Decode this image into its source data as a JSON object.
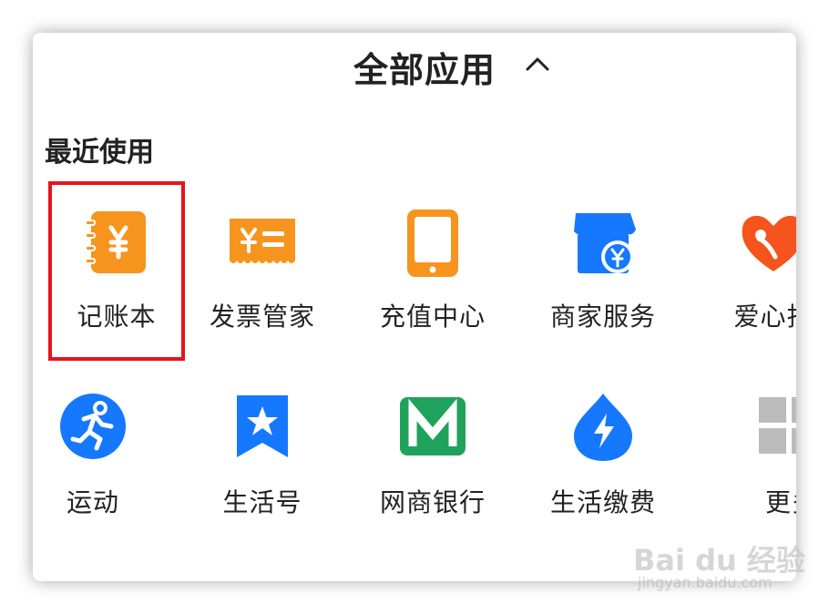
{
  "header": {
    "title": "全部应用",
    "collapse_icon": "chevron-up-icon"
  },
  "recent": {
    "title": "最近使用",
    "items": [
      {
        "label": "记账本",
        "icon": "ledger-icon",
        "color": "#f7941d",
        "highlighted": true
      },
      {
        "label": "发票管家",
        "icon": "invoice-icon",
        "color": "#f7941d"
      },
      {
        "label": "充值中心",
        "icon": "tablet-icon",
        "color": "#f7941d"
      },
      {
        "label": "商家服务",
        "icon": "store-icon",
        "color": "#1677ff"
      },
      {
        "label": "爱心捐",
        "icon": "heart-donation-icon",
        "color": "#f5541c"
      }
    ]
  },
  "more": {
    "items": [
      {
        "label": "运动",
        "icon": "running-icon",
        "color": "#1677ff"
      },
      {
        "label": "生活号",
        "icon": "star-bookmark-icon",
        "color": "#1677ff"
      },
      {
        "label": "网商银行",
        "icon": "mybank-icon",
        "color": "#1fa35c"
      },
      {
        "label": "生活缴费",
        "icon": "lightning-drop-icon",
        "color": "#1677ff"
      },
      {
        "label": "更多",
        "icon": "grid-icon",
        "color": "#bbbbbb"
      }
    ]
  },
  "colors": {
    "highlight": "#e8131b",
    "text": "#222222"
  },
  "watermark": {
    "main": "Bai du 经验",
    "sub": "jingyan.baidu.com"
  }
}
